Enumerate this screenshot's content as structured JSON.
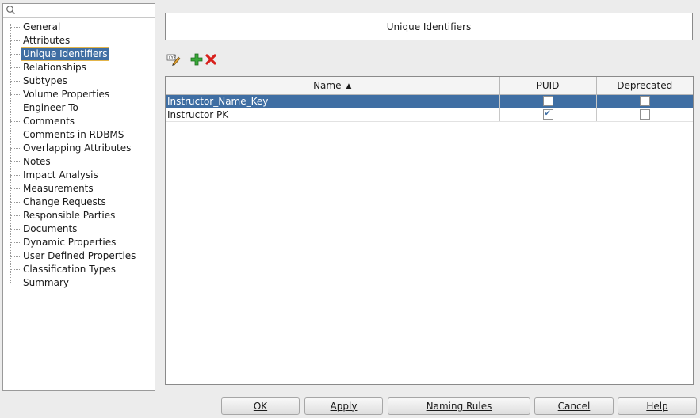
{
  "nav": {
    "search_placeholder": "",
    "items": [
      {
        "label": "General"
      },
      {
        "label": "Attributes"
      },
      {
        "label": "Unique Identifiers",
        "selected": true
      },
      {
        "label": "Relationships"
      },
      {
        "label": "Subtypes"
      },
      {
        "label": "Volume Properties"
      },
      {
        "label": "Engineer To"
      },
      {
        "label": "Comments"
      },
      {
        "label": "Comments in RDBMS"
      },
      {
        "label": "Overlapping Attributes"
      },
      {
        "label": "Notes"
      },
      {
        "label": "Impact Analysis"
      },
      {
        "label": "Measurements"
      },
      {
        "label": "Change Requests"
      },
      {
        "label": "Responsible Parties"
      },
      {
        "label": "Documents"
      },
      {
        "label": "Dynamic Properties"
      },
      {
        "label": "User Defined Properties"
      },
      {
        "label": "Classification Types"
      },
      {
        "label": "Summary"
      }
    ]
  },
  "panel": {
    "title": "Unique Identifiers"
  },
  "toolbar": {
    "icons": [
      "edit-properties-icon",
      "add-icon",
      "delete-icon"
    ]
  },
  "table": {
    "columns": [
      "Name",
      "PUID",
      "Deprecated"
    ],
    "sort_indicator": "▲",
    "rows": [
      {
        "name": "Instructor_Name_Key",
        "puid": false,
        "deprecated": false,
        "selected": true
      },
      {
        "name": "Instructor PK",
        "puid": true,
        "deprecated": false,
        "selected": false
      }
    ]
  },
  "buttons": {
    "ok": "OK",
    "apply": "Apply",
    "naming_rules": "Naming Rules",
    "cancel": "Cancel",
    "help": "Help"
  },
  "colors": {
    "selection": "#3f6ea3",
    "add": "#2e9e2e",
    "delete": "#d8201c"
  }
}
